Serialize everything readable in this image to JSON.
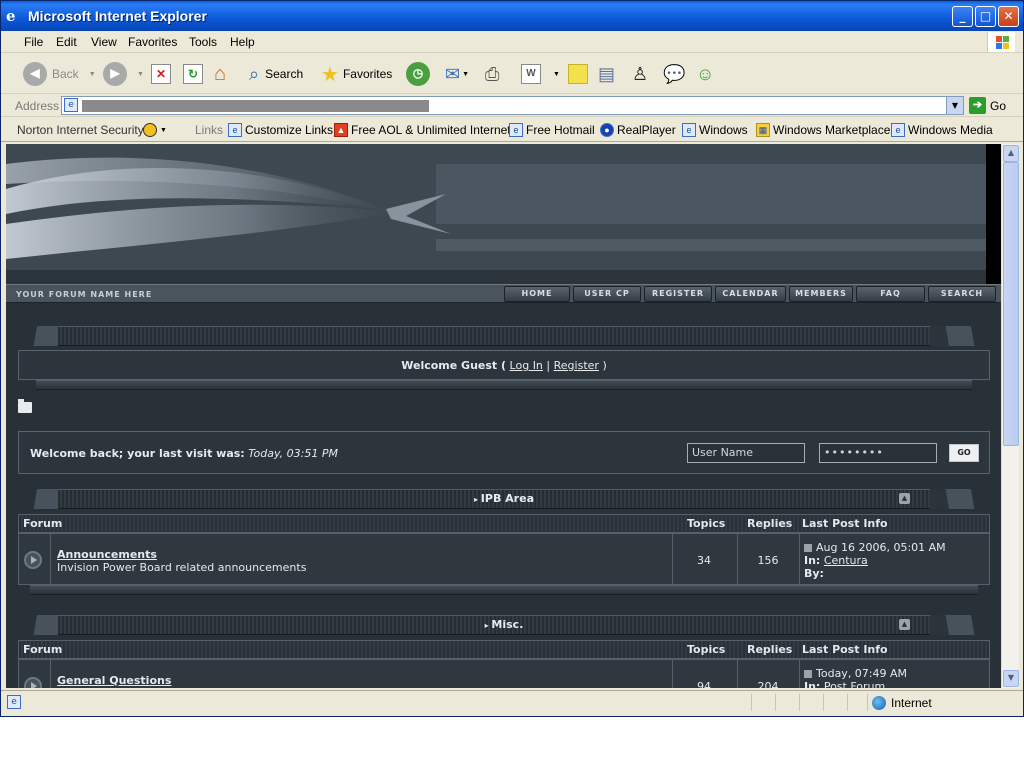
{
  "window": {
    "title": "Microsoft Internet Explorer"
  },
  "menu": [
    "File",
    "Edit",
    "View",
    "Favorites",
    "Tools",
    "Help"
  ],
  "toolbar": {
    "back": "Back",
    "search": "Search",
    "favorites": "Favorites"
  },
  "address": {
    "label": "Address",
    "go": "Go"
  },
  "links": {
    "norton": "Norton Internet Security",
    "label": "Links",
    "items": [
      "Customize Links",
      "Free AOL & Unlimited Internet",
      "Free Hotmail",
      "RealPlayer",
      "Windows",
      "Windows Marketplace",
      "Windows Media"
    ]
  },
  "forum": {
    "name": "YOUR FORUM NAME HERE",
    "nav": [
      "HOME",
      "USER CP",
      "REGISTER",
      "CALENDAR",
      "MEMBERS",
      "FAQ",
      "SEARCH"
    ],
    "welcome": {
      "text": "Welcome Guest (",
      "login": "Log In",
      "sep": "|",
      "register": "Register",
      "close": ")"
    },
    "lastvisit": {
      "label": "Welcome back; your last visit was:",
      "value": "Today, 03:51 PM"
    },
    "login": {
      "username": "User Name",
      "password": "••••••••",
      "go": "GO"
    },
    "columns": {
      "forum": "Forum",
      "topics": "Topics",
      "replies": "Replies",
      "lastpost": "Last Post Info"
    },
    "categories": [
      {
        "title": "IPB Area",
        "rows": [
          {
            "name": "Announcements",
            "desc": "Invision Power Board related announcements",
            "topics": "34",
            "replies": "156",
            "date": "Aug 16 2006, 05:01 AM",
            "in_label": "In:",
            "in": "Centura",
            "by_label": "By:",
            "by": ""
          }
        ]
      },
      {
        "title": "Misc.",
        "rows": [
          {
            "name": "General Questions",
            "desc": "",
            "topics": "94",
            "replies": "204",
            "date": "Today, 07:49 AM",
            "in_label": "In:",
            "in": "Post Forum",
            "by_label": "",
            "by": ""
          }
        ]
      }
    ]
  },
  "status": {
    "zone": "Internet"
  },
  "colors": {
    "titlebar": "#0a58d8",
    "forum_bg": "#283038",
    "chrome": "#ece9d8"
  }
}
